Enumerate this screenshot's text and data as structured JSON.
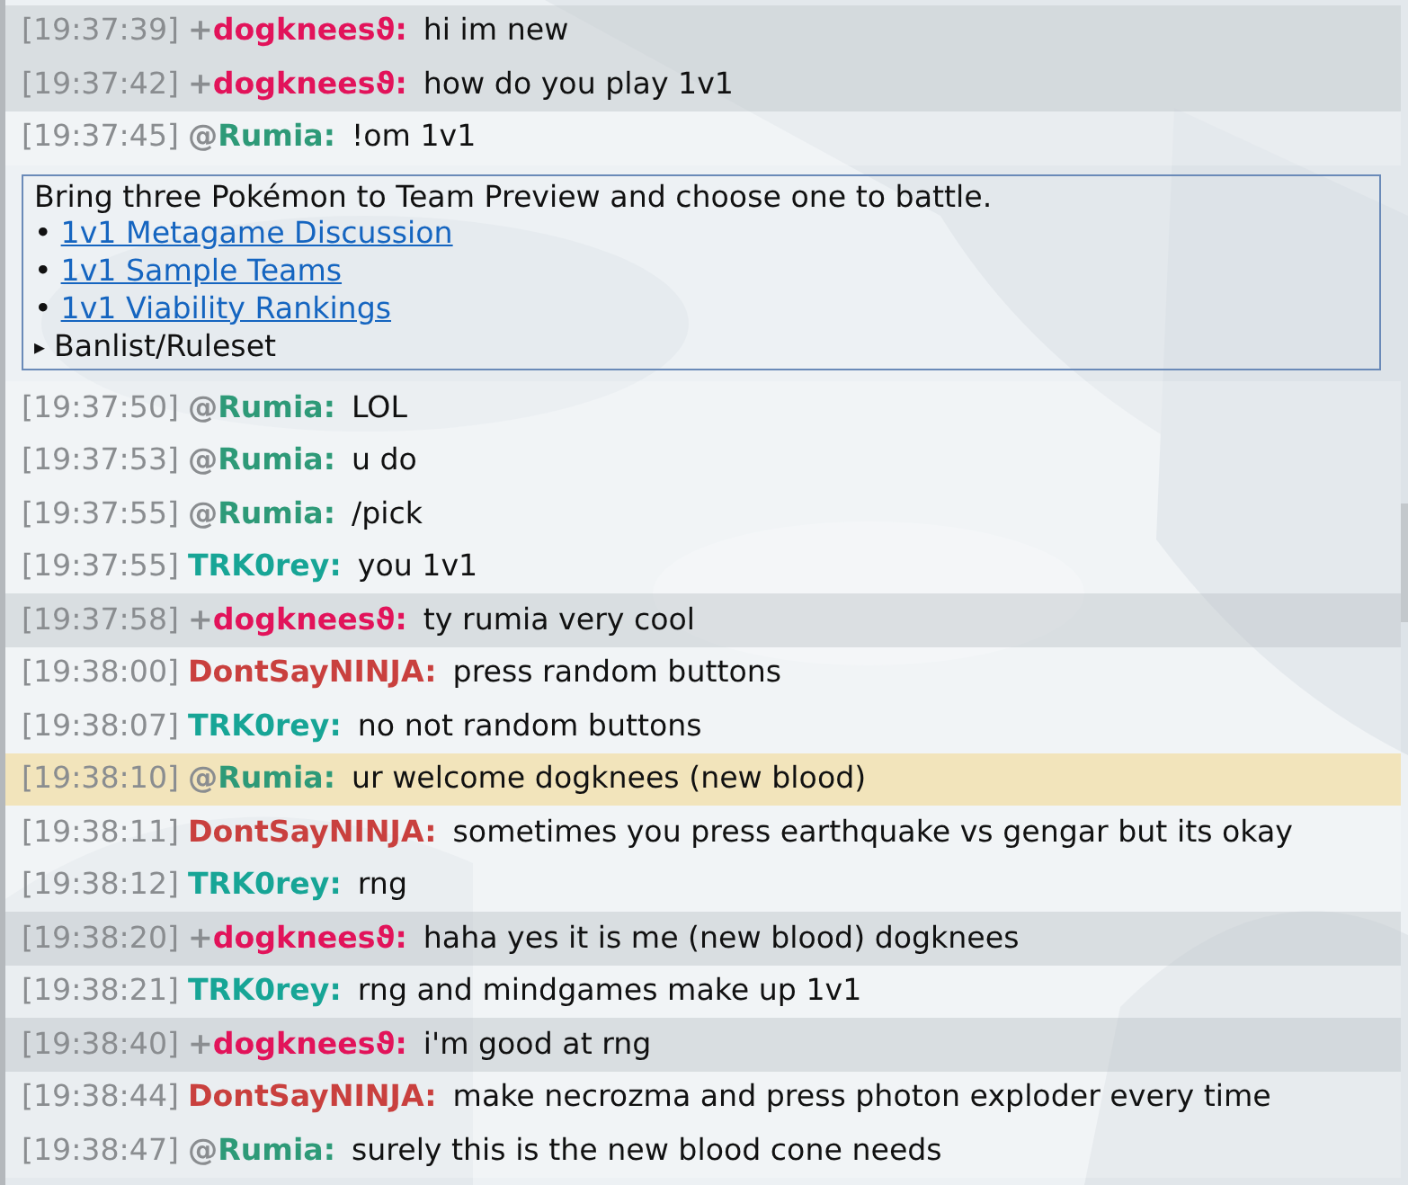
{
  "messages": [
    {
      "kind": "chat",
      "time": "[19:37:39]",
      "rank": "+",
      "name": "dogkneesϑ:",
      "color": "#e2135a",
      "text": "hi im new",
      "shaded": true,
      "mentioned": false
    },
    {
      "kind": "chat",
      "time": "[19:37:42]",
      "rank": "+",
      "name": "dogkneesϑ:",
      "color": "#e2135a",
      "text": "how do you play 1v1",
      "shaded": true,
      "mentioned": false
    },
    {
      "kind": "chat",
      "time": "[19:37:45]",
      "rank": "@",
      "name": "Rumia:",
      "color": "#2e9a78",
      "text": "!om 1v1",
      "shaded": false,
      "mentioned": false
    },
    {
      "kind": "infobox",
      "text": "Bring three Pokémon to Team Preview and choose one to battle.",
      "links": [
        {
          "bullet": "•",
          "label": "1v1 Metagame Discussion"
        },
        {
          "bullet": "•",
          "label": "1v1 Sample Teams"
        },
        {
          "bullet": "•",
          "label": "1v1 Viability Rankings"
        }
      ],
      "details": {
        "marker": "▸",
        "summary": "Banlist/Ruleset",
        "expanded": false
      }
    },
    {
      "kind": "chat",
      "time": "[19:37:50]",
      "rank": "@",
      "name": "Rumia:",
      "color": "#2e9a78",
      "text": "LOL",
      "shaded": false,
      "mentioned": false
    },
    {
      "kind": "chat",
      "time": "[19:37:53]",
      "rank": "@",
      "name": "Rumia:",
      "color": "#2e9a78",
      "text": "u do",
      "shaded": false,
      "mentioned": false
    },
    {
      "kind": "chat",
      "time": "[19:37:55]",
      "rank": "@",
      "name": "Rumia:",
      "color": "#2e9a78",
      "text": "/pick",
      "shaded": false,
      "mentioned": false
    },
    {
      "kind": "chat",
      "time": "[19:37:55]",
      "name": "TRK0rey:",
      "color": "#17a596",
      "text": "you 1v1",
      "shaded": false,
      "mentioned": false
    },
    {
      "kind": "chat",
      "time": "[19:37:58]",
      "rank": "+",
      "name": "dogkneesϑ:",
      "color": "#e2135a",
      "text": "ty rumia very cool",
      "shaded": true,
      "mentioned": false
    },
    {
      "kind": "chat",
      "time": "[19:38:00]",
      "name": "DontSayNINJA:",
      "color": "#c9403e",
      "text": "press random buttons",
      "shaded": false,
      "mentioned": false
    },
    {
      "kind": "chat",
      "time": "[19:38:07]",
      "name": "TRK0rey:",
      "color": "#17a596",
      "text": "no not random buttons",
      "shaded": false,
      "mentioned": false
    },
    {
      "kind": "chat",
      "time": "[19:38:10]",
      "rank": "@",
      "name": "Rumia:",
      "color": "#2e9a78",
      "text": "ur welcome dogknees (new blood)",
      "shaded": false,
      "mentioned": true
    },
    {
      "kind": "chat",
      "time": "[19:38:11]",
      "name": "DontSayNINJA:",
      "color": "#c9403e",
      "text": "sometimes you press earthquake vs gengar but its okay",
      "shaded": false,
      "mentioned": false
    },
    {
      "kind": "chat",
      "time": "[19:38:12]",
      "name": "TRK0rey:",
      "color": "#17a596",
      "text": "rng",
      "shaded": false,
      "mentioned": false
    },
    {
      "kind": "chat",
      "time": "[19:38:20]",
      "rank": "+",
      "name": "dogkneesϑ:",
      "color": "#e2135a",
      "text": "haha yes it is me (new blood) dogknees",
      "shaded": true,
      "mentioned": false
    },
    {
      "kind": "chat",
      "time": "[19:38:21]",
      "name": "TRK0rey:",
      "color": "#17a596",
      "text": "rng and mindgames make up 1v1",
      "shaded": false,
      "mentioned": false
    },
    {
      "kind": "chat",
      "time": "[19:38:40]",
      "rank": "+",
      "name": "dogkneesϑ:",
      "color": "#e2135a",
      "text": "i'm good at rng",
      "shaded": true,
      "mentioned": false
    },
    {
      "kind": "chat",
      "time": "[19:38:44]",
      "name": "DontSayNINJA:",
      "color": "#c9403e",
      "text": "make necrozma and press photon exploder every time",
      "shaded": false,
      "mentioned": false
    },
    {
      "kind": "chat",
      "time": "[19:38:47]",
      "rank": "@",
      "name": "Rumia:",
      "color": "#2e9a78",
      "text": "surely this is the new blood cone needs",
      "shaded": false,
      "mentioned": false
    }
  ]
}
